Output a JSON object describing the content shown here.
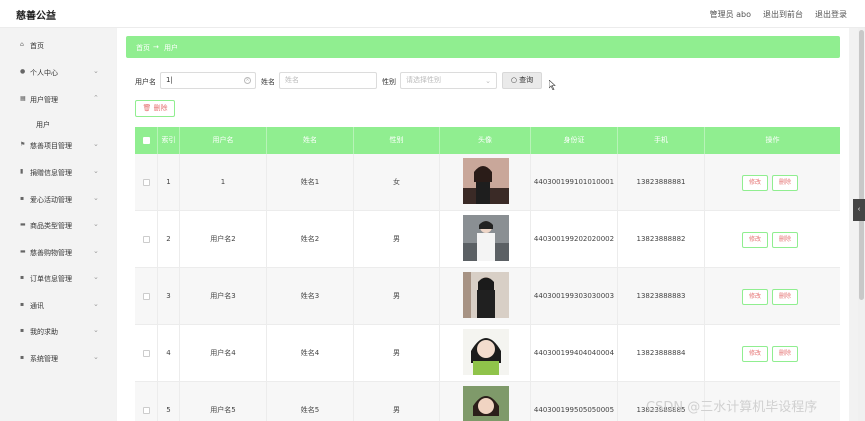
{
  "header": {
    "brand": "慈善公益",
    "admin": "管理员 abo",
    "exit_front": "退出到前台",
    "logout": "退出登录"
  },
  "sidebar": {
    "items": [
      {
        "label": "首页",
        "icon": "home-icon",
        "has_arrow": false
      },
      {
        "label": "个人中心",
        "icon": "user-icon",
        "has_arrow": true
      },
      {
        "label": "用户管理",
        "icon": "grid-icon",
        "has_arrow": true
      },
      {
        "label": "慈善项目管理",
        "icon": "flag-icon",
        "has_arrow": true
      },
      {
        "label": "捐赠信息管理",
        "icon": "chart-icon",
        "has_arrow": true
      },
      {
        "label": "爱心活动管理",
        "icon": "apps-icon",
        "has_arrow": true
      },
      {
        "label": "商品类型管理",
        "icon": "box-icon",
        "has_arrow": true
      },
      {
        "label": "慈善购物管理",
        "icon": "box-icon",
        "has_arrow": true
      },
      {
        "label": "订单信息管理",
        "icon": "apps-icon",
        "has_arrow": true
      },
      {
        "label": "通讯",
        "icon": "apps-icon",
        "has_arrow": true
      },
      {
        "label": "我的求助",
        "icon": "apps-icon",
        "has_arrow": true
      },
      {
        "label": "系统管理",
        "icon": "apps-icon",
        "has_arrow": true
      }
    ],
    "subitem": "用户"
  },
  "breadcrumb": {
    "home": "首页",
    "sep": "→",
    "current": "用户"
  },
  "search": {
    "username_label": "用户名",
    "username_value": "1|",
    "name_label": "姓名",
    "name_placeholder": "姓名",
    "gender_label": "性别",
    "gender_placeholder": "请选择性别",
    "query_label": "查询"
  },
  "delete_label": "删除",
  "table": {
    "headers": [
      "",
      "索引",
      "用户名",
      "姓名",
      "性别",
      "头像",
      "身份证",
      "手机",
      "操作"
    ],
    "edit_label": "修改",
    "delete_label": "删除",
    "rows": [
      {
        "index": "1",
        "username": "1",
        "name": "姓名1",
        "gender": "女",
        "idcard": "440300199101010001",
        "phone": "13823888881"
      },
      {
        "index": "2",
        "username": "用户名2",
        "name": "姓名2",
        "gender": "男",
        "idcard": "440300199202020002",
        "phone": "13823888882"
      },
      {
        "index": "3",
        "username": "用户名3",
        "name": "姓名3",
        "gender": "男",
        "idcard": "440300199303030003",
        "phone": "13823888883"
      },
      {
        "index": "4",
        "username": "用户名4",
        "name": "姓名4",
        "gender": "男",
        "idcard": "440300199404040004",
        "phone": "13823888884"
      },
      {
        "index": "5",
        "username": "用户名5",
        "name": "姓名5",
        "gender": "男",
        "idcard": "440300199505050005",
        "phone": "13823888885"
      }
    ]
  },
  "watermark": "CSDN @三水计算机毕设程序",
  "colors": {
    "accent": "#90ee90",
    "danger_text": "#e57373"
  }
}
